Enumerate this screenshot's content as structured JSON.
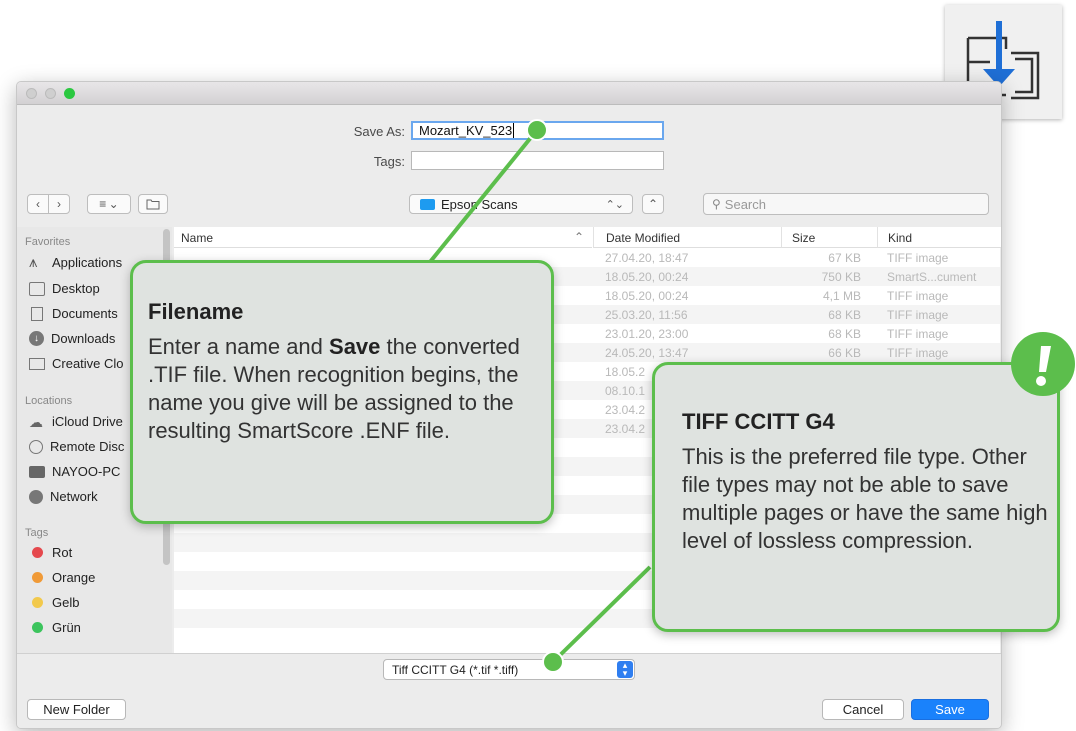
{
  "save_as_label": "Save As:",
  "save_as_value": "Mozart_KV_523",
  "tags_label": "Tags:",
  "location": "Epson Scans",
  "search_placeholder": "Search",
  "sidebar": {
    "favorites_head": "Favorites",
    "favorites": [
      "Applications",
      "Desktop",
      "Documents",
      "Downloads",
      "Creative Clo"
    ],
    "locations_head": "Locations",
    "locations": [
      "iCloud Drive",
      "Remote Disc",
      "NAYOO-PC",
      "Network"
    ],
    "tags_head": "Tags",
    "tags": [
      {
        "label": "Rot",
        "color": "#e5484d"
      },
      {
        "label": "Orange",
        "color": "#f09a37"
      },
      {
        "label": "Gelb",
        "color": "#f2c94c"
      },
      {
        "label": "Grün",
        "color": "#3cc45d"
      }
    ]
  },
  "columns": {
    "name": "Name",
    "date": "Date Modified",
    "size": "Size",
    "kind": "Kind"
  },
  "files": [
    {
      "date": "27.04.20, 18:47",
      "size": "67 KB",
      "kind": "TIFF image"
    },
    {
      "date": "18.05.20, 00:24",
      "size": "750 KB",
      "kind": "SmartS...cument"
    },
    {
      "date": "18.05.20, 00:24",
      "size": "4,1 MB",
      "kind": "TIFF image"
    },
    {
      "date": "25.03.20, 11:56",
      "size": "68 KB",
      "kind": "TIFF image"
    },
    {
      "date": "23.01.20, 23:00",
      "size": "68 KB",
      "kind": "TIFF image"
    },
    {
      "date": "24.05.20, 13:47",
      "size": "66 KB",
      "kind": "TIFF image"
    },
    {
      "date": "18.05.2",
      "size": "",
      "kind": ""
    },
    {
      "date": "08.10.1",
      "size": "",
      "kind": ""
    },
    {
      "date": "23.04.2",
      "size": "",
      "kind": ""
    },
    {
      "date": "23.04.2",
      "size": "",
      "kind": ""
    }
  ],
  "format": "Tiff CCITT G4 (*.tif *.tiff)",
  "new_folder": "New Folder",
  "cancel": "Cancel",
  "save": "Save",
  "callout_filename": {
    "title": "Filename",
    "line1_pre": "Enter a name and ",
    "line1_bold": "Save",
    "line1_post": " the",
    "rest": "converted .TIF file. When recognition begins, the name you give will be assigned to the resulting SmartScore .ENF file."
  },
  "callout_tiff": {
    "title": "TIFF CCITT G4",
    "body": "This is the preferred file type. Other file types may not be able to save multiple pages or have the same high level of lossless compression."
  },
  "colors": {
    "accent": "#5cbe4c",
    "save_button": "#1a82fb",
    "folder": "#1d9bf0"
  }
}
